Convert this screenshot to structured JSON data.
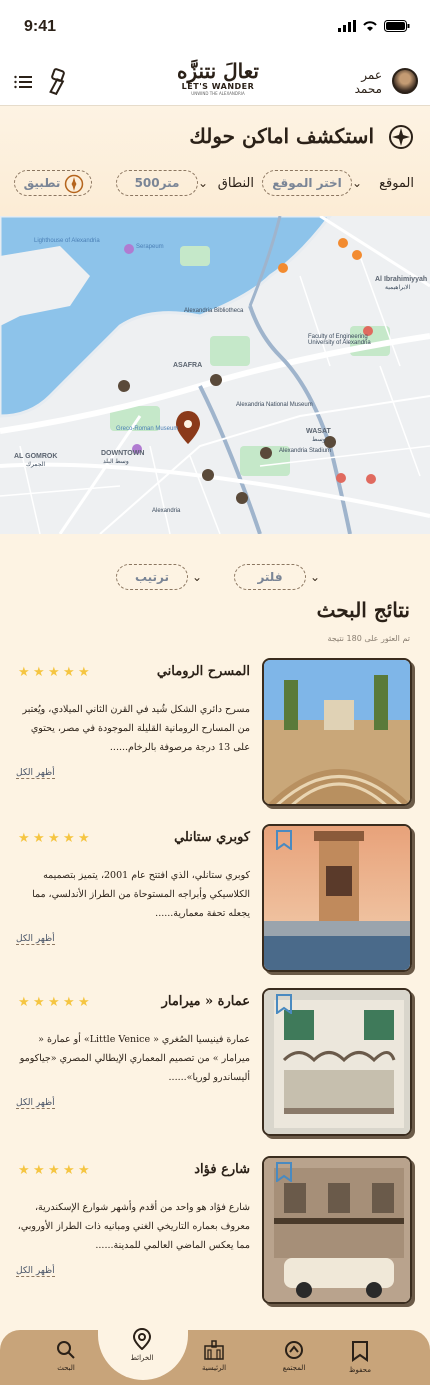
{
  "status": {
    "time": "9:41"
  },
  "header": {
    "user_name_line1": "عمر",
    "user_name_line2": "محمد",
    "logo_ar": "تعالَ نتنزَّه",
    "logo_en": "LET'S WANDER",
    "logo_sub": "UNWIND THE ALEXANDRIA"
  },
  "explore": {
    "title": "استكشف اماكن حولك",
    "location_label": "الموقع",
    "location_value": "اختر الموقع",
    "range_label": "النطاق",
    "range_value": "500متر",
    "apply_label": "تطبيق"
  },
  "map": {
    "labels": {
      "lighthouse": "Lighthouse of Alexandria",
      "downtown_en": "DOWNTOWN",
      "downtown_ar": "وسط البلد",
      "gomrok_en": "AL GOMROK",
      "gomrok_ar": "الجمرك",
      "wasat_en": "WASAT",
      "wasat_ar": "وسط",
      "asafra": "ASAFRA",
      "bibliotheca": "Alexandria Bibliotheca",
      "national_museum": "Alexandria National Museum",
      "greco_roman": "Greco-Roman Museum",
      "ibrahimiyyah_en": "Al Ibrahimiyyah",
      "ibrahimiyyah_ar": "الابراهيمية",
      "faculty": "Faculty of Engineering University of Alexandria",
      "stadium": "Alexandria Stadium",
      "alexandria": "Alexandria",
      "serapeum": "Serapeum"
    }
  },
  "results": {
    "sort_label": "ترتيب",
    "filter_label": "فلتر",
    "title": "نتائج البحث",
    "count_text": "تم العثور على 180 نتيجة",
    "show_all_label": "أظهر الكل",
    "items": [
      {
        "title": "المسرح الروماني",
        "desc": "مسرح دائري الشكل شُيد في القرن الثاني الميلادي، ويُعتبر من المسارح الرومانية القليلة الموجودة في مصر، يحتوي على 13 درجة مرصوفة بالرخام......",
        "rating": 5
      },
      {
        "title": "كوبري ستانلي",
        "desc": "كوبري ستانلي، الذي افتتح عام 2001، يتميز بتصميمه الكلاسيكي وأبراجه المستوحاة من الطراز الأندلسي، مما يجعله تحفة معمارية......",
        "rating": 5
      },
      {
        "title": "عمارة « ميرامار",
        "desc": "عمارة فينيسيا الصُغري « Little Venice» أو عمارة « ميرامار » من تصميم المعماري الإيطالي المصري «جياكومو أليساندرو لوريا»......",
        "rating": 5
      },
      {
        "title": "شارع فؤاد",
        "desc": "شارع فؤاد هو واحد من أقدم وأشهر شوارع الإسكندرية، معروف بعماره التاريخي الغني ومبانيه ذات الطراز الأوروبي، مما يعكس الماضي العالمي للمدينة......",
        "rating": 5
      }
    ]
  },
  "nav": {
    "search": "البحث",
    "maps": "الخرائط",
    "home": "الرئيسية",
    "community": "المجتمع",
    "saved": "محفوظ"
  },
  "colors": {
    "background": "#fdf3e3",
    "nav": "#c8a47a",
    "accent_brown": "#3a2c1e",
    "pin": "#8b3a1a",
    "star": "#f5c542"
  }
}
